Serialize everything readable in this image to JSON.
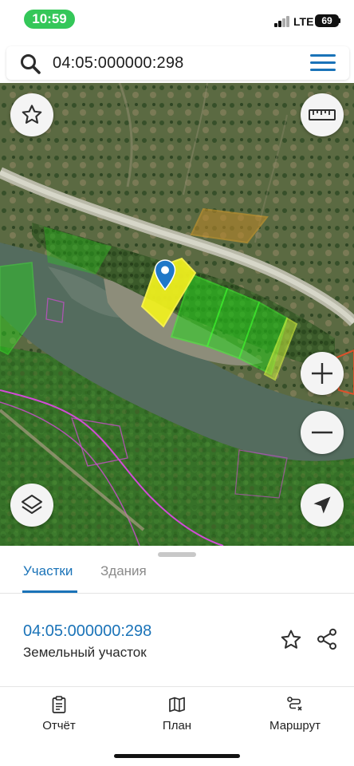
{
  "status_bar": {
    "time": "10:59",
    "network": "LTE",
    "battery": "69",
    "time_pill_color": "#34c759"
  },
  "search": {
    "value": "04:05:000000:298",
    "icon": "search-icon",
    "menu_icon": "hamburger-menu-icon"
  },
  "map": {
    "buttons": [
      "star-icon",
      "ruler-icon",
      "zoom-in-icon",
      "zoom-out-icon",
      "layers-icon",
      "locate-arrow-icon"
    ],
    "marker": "location-pin-icon",
    "selected_parcel_color": "#f2f21e",
    "parcel_outline_color": "#23e01c"
  },
  "sheet": {
    "tabs": [
      {
        "label": "Участки",
        "active": true
      },
      {
        "label": "Здания",
        "active": false
      }
    ],
    "result": {
      "cadastral_number": "04:05:000000:298",
      "type": "Земельный участок"
    },
    "accent_color": "#1a73b8"
  },
  "bottom_nav": {
    "items": [
      {
        "label": "Отчёт",
        "icon": "report-clipboard-icon"
      },
      {
        "label": "План",
        "icon": "map-plan-icon"
      },
      {
        "label": "Маршрут",
        "icon": "route-icon"
      }
    ]
  }
}
